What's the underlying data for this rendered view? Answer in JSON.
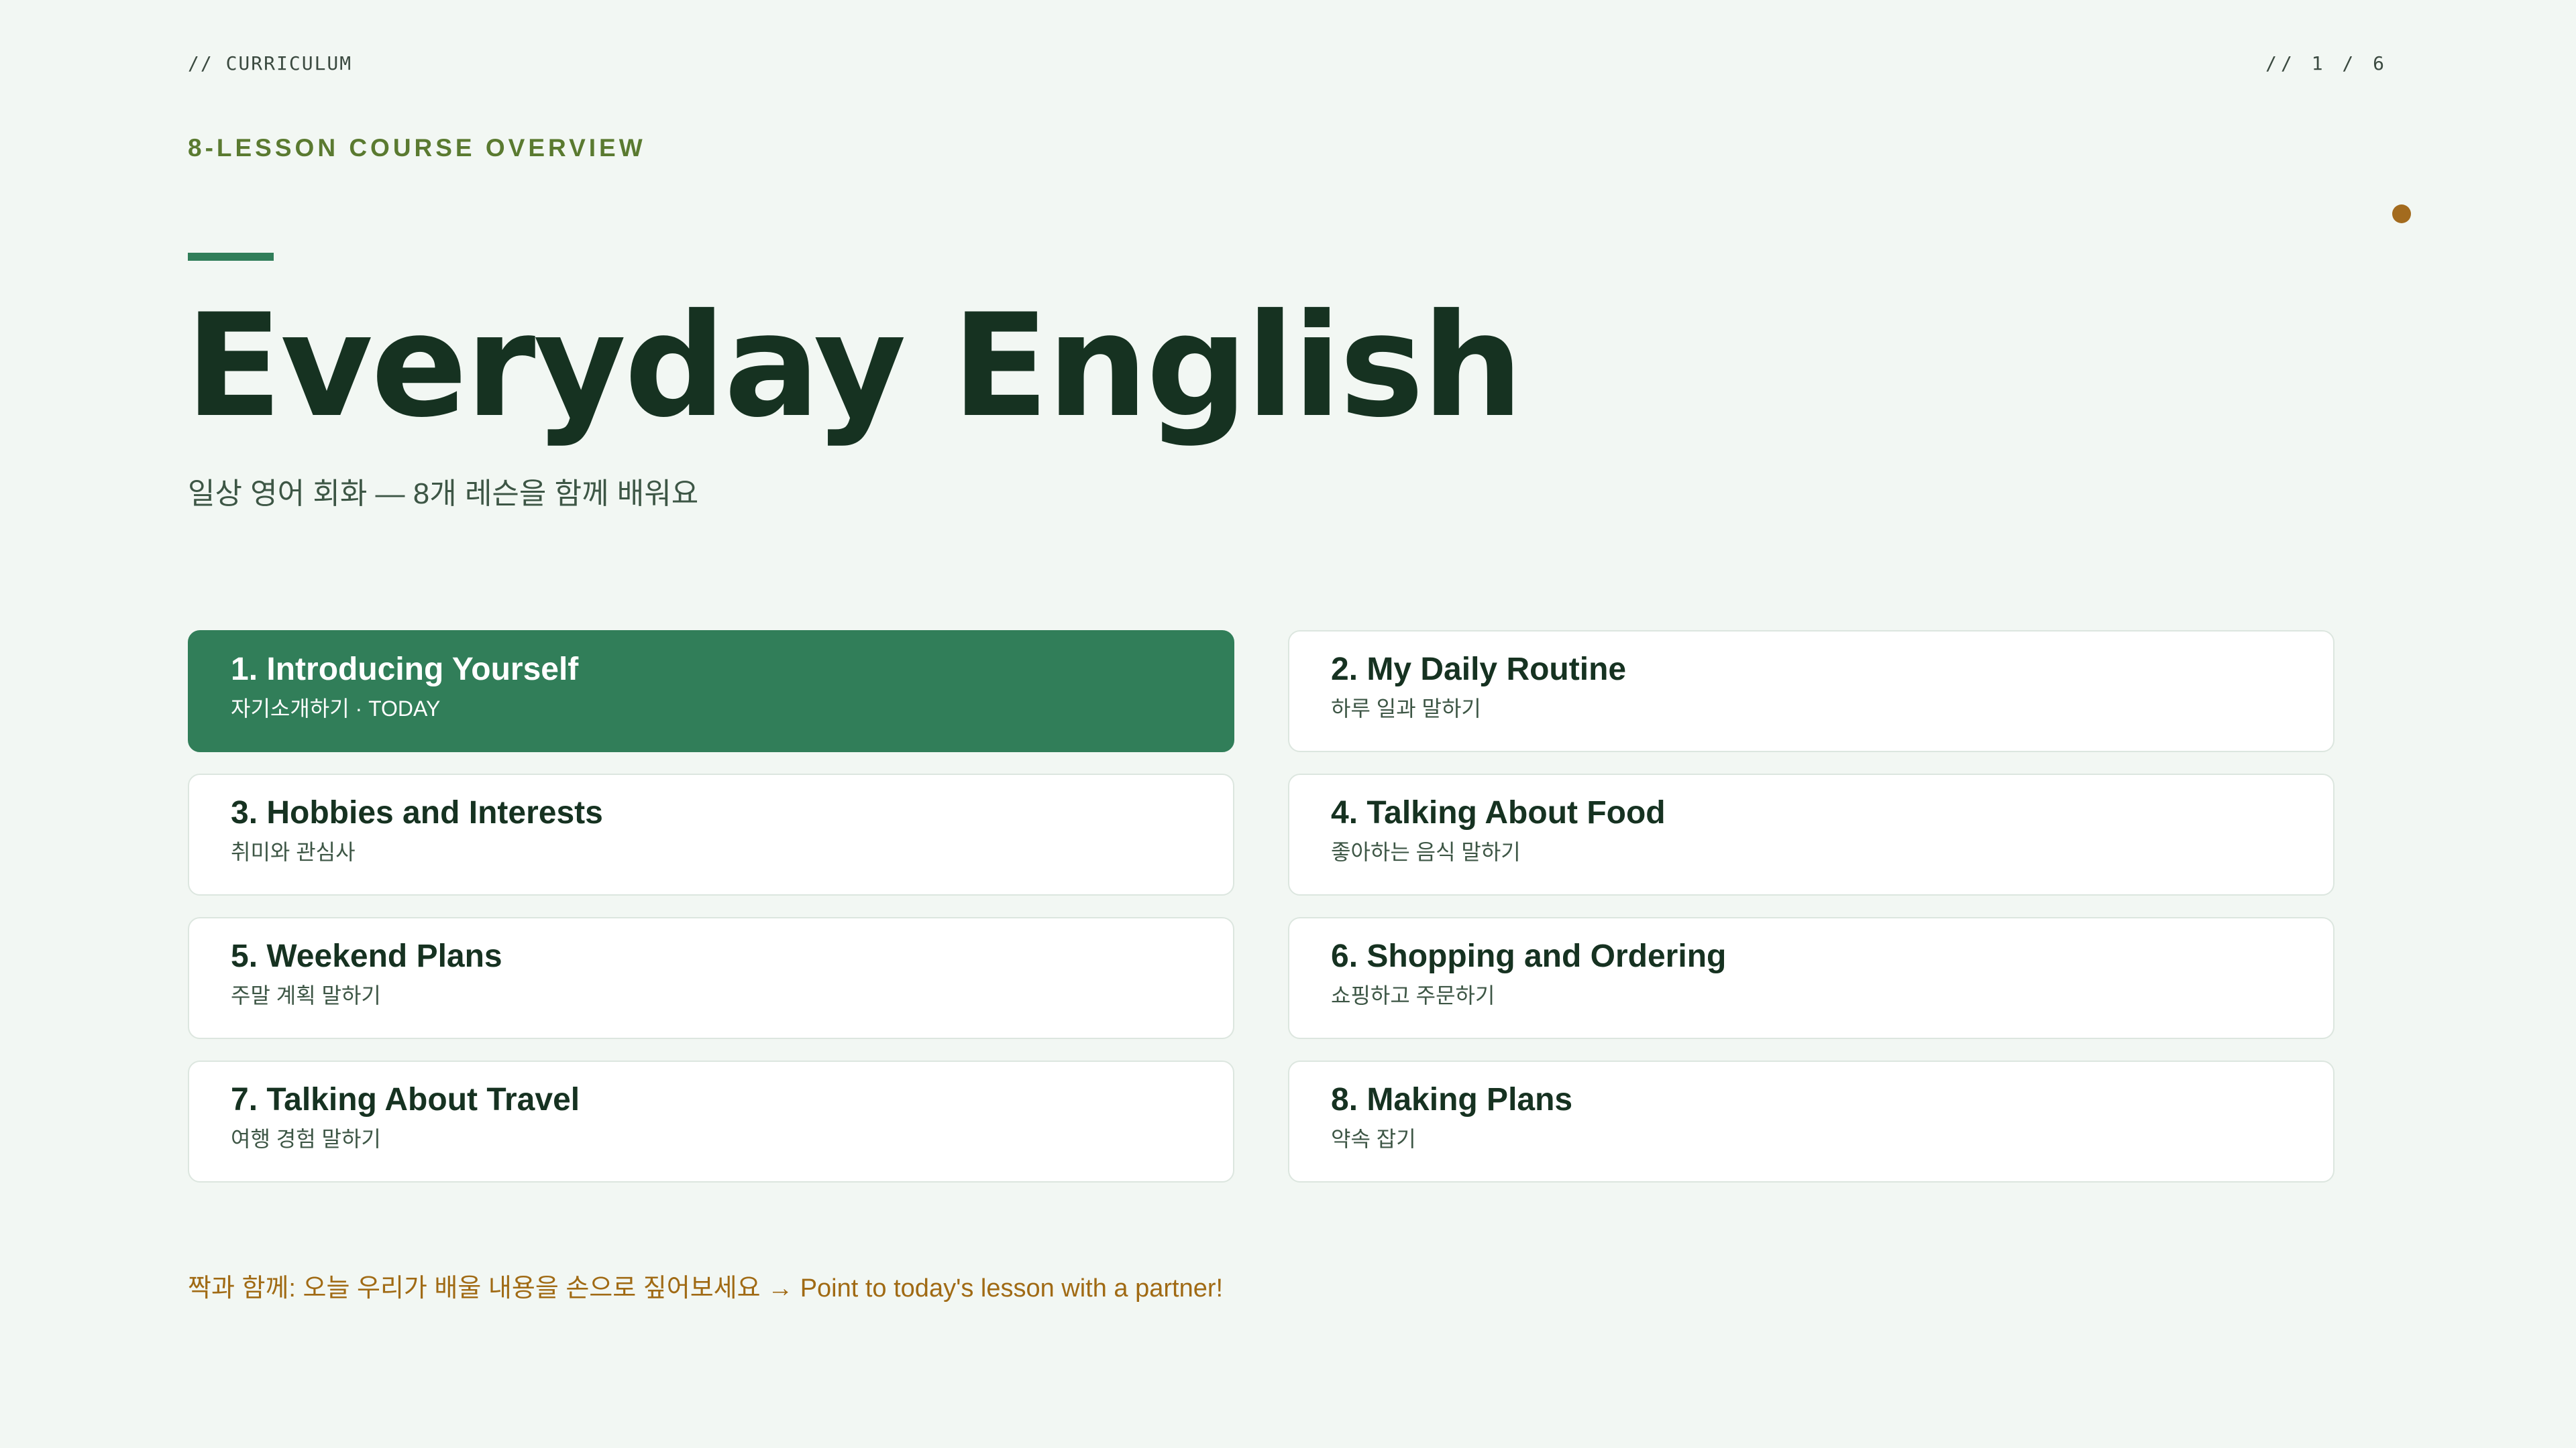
{
  "header": {
    "section_label": "// CURRICULUM",
    "page_indicator": "// 1 / 6"
  },
  "eyebrow": "8-LESSON COURSE OVERVIEW",
  "title": "Everyday English",
  "subtitle": "일상 영어 회화 — 8개 레슨을 함께 배워요",
  "lessons": [
    {
      "title": "1. Introducing Yourself",
      "subtitle": "자기소개하기 · TODAY",
      "active": true
    },
    {
      "title": "2. My Daily Routine",
      "subtitle": "하루 일과 말하기",
      "active": false
    },
    {
      "title": "3. Hobbies and Interests",
      "subtitle": "취미와 관심사",
      "active": false
    },
    {
      "title": "4. Talking About Food",
      "subtitle": "좋아하는 음식 말하기",
      "active": false
    },
    {
      "title": "5. Weekend Plans",
      "subtitle": "주말 계획 말하기",
      "active": false
    },
    {
      "title": "6. Shopping and Ordering",
      "subtitle": "쇼핑하고 주문하기",
      "active": false
    },
    {
      "title": "7. Talking About Travel",
      "subtitle": "여행 경험 말하기",
      "active": false
    },
    {
      "title": "8. Making Plans",
      "subtitle": "약속 잡기",
      "active": false
    }
  ],
  "footer_note": "짝과 함께: 오늘 우리가 배울 내용을 손으로 짚어보세요 →  Point to today's lesson with a partner!",
  "colors": {
    "background": "#f2f7f3",
    "accent_green": "#317e59",
    "accent_amber": "#a36b1e",
    "eyebrow_olive": "#5a7a30",
    "title_dark": "#163221"
  }
}
